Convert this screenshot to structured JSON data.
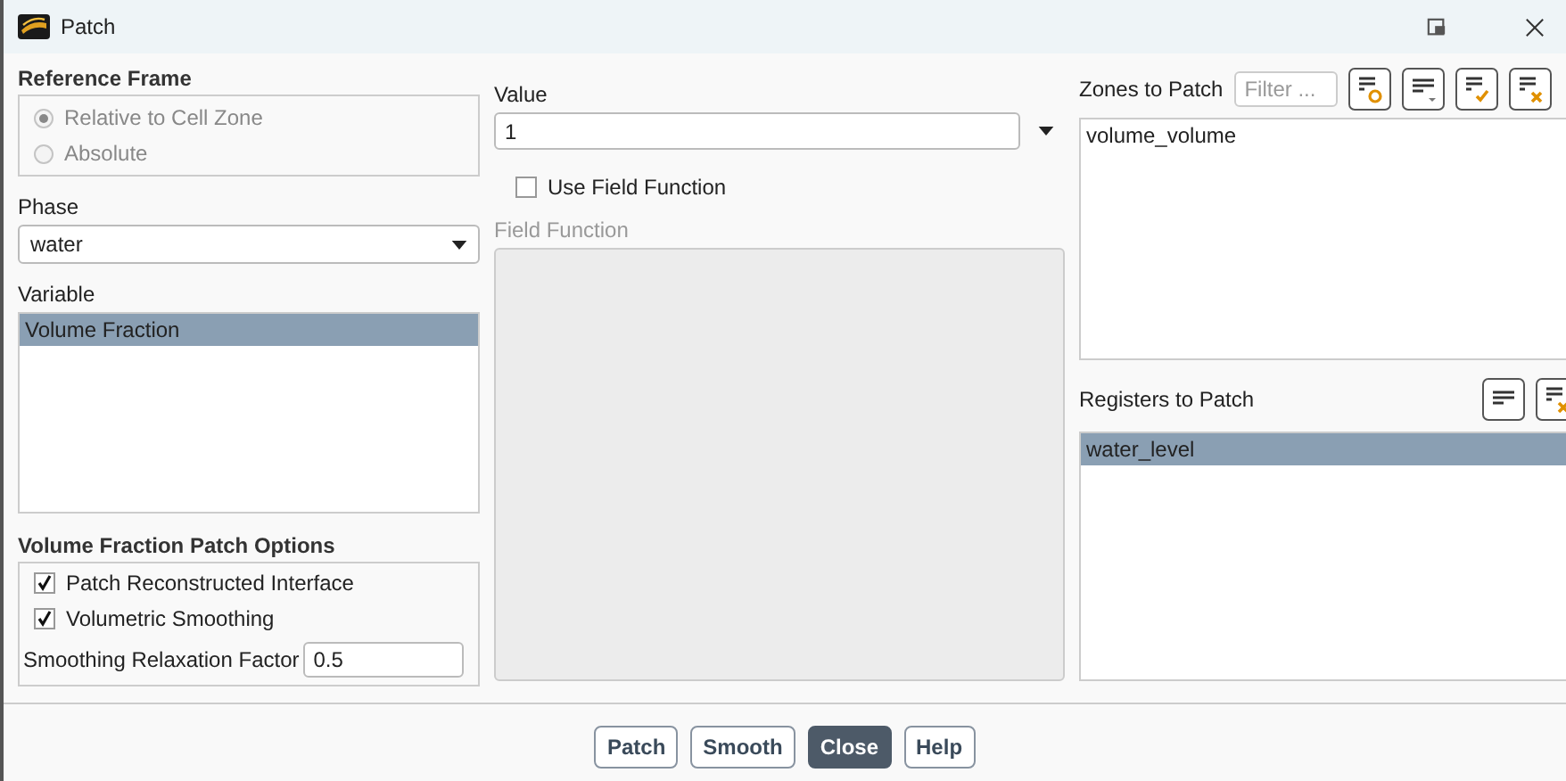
{
  "window": {
    "title": "Patch"
  },
  "reference_frame": {
    "title": "Reference Frame",
    "disabled": true,
    "options": [
      {
        "label": "Relative to Cell Zone",
        "selected": true
      },
      {
        "label": "Absolute",
        "selected": false
      }
    ]
  },
  "phase": {
    "label": "Phase",
    "value": "water"
  },
  "variable": {
    "label": "Variable",
    "items": [
      {
        "label": "Volume Fraction",
        "selected": true
      }
    ]
  },
  "vof_options": {
    "title": "Volume Fraction Patch Options",
    "checkboxes": [
      {
        "label": "Patch Reconstructed Interface",
        "checked": true
      },
      {
        "label": "Volumetric Smoothing",
        "checked": true
      }
    ],
    "factor": {
      "label": "Smoothing Relaxation Factor",
      "value": "0.5"
    }
  },
  "value": {
    "label": "Value",
    "value": "1"
  },
  "use_field_function": {
    "label": "Use Field Function",
    "checked": false
  },
  "field_function": {
    "label": "Field Function",
    "disabled": true
  },
  "zones": {
    "label": "Zones to Patch",
    "filter_placeholder": "Filter ...",
    "items": [
      {
        "label": "volume_volume",
        "selected": false
      }
    ]
  },
  "registers": {
    "label": "Registers to Patch",
    "items": [
      {
        "label": "water_level",
        "selected": true
      }
    ]
  },
  "buttons": [
    {
      "label": "Patch",
      "default": false
    },
    {
      "label": "Smooth",
      "default": false
    },
    {
      "label": "Close",
      "default": true
    },
    {
      "label": "Help",
      "default": false
    }
  ]
}
